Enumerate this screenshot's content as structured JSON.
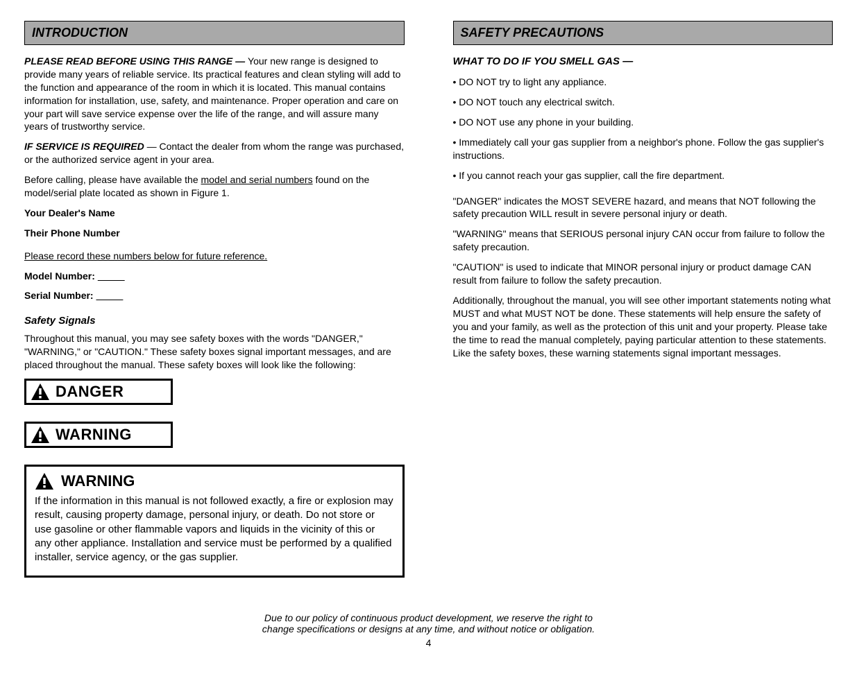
{
  "left": {
    "section_title": "INTRODUCTION",
    "intro_lead": "PLEASE READ BEFORE USING THIS RANGE — ",
    "intro_body": "Your new range is designed to provide many years of reliable service. Its practical features and clean styling will add to the function and appearance of the room in which it is located. This manual contains information for installation, use, safety, and maintenance. Proper operation and care on your part will save service expense over the life of the range, and will assure many years of trustworthy service.",
    "service_lead": "IF SERVICE IS REQUIRED ",
    "service_body1": "— Contact the dealer from whom the range was purchased, or the authorized service agent in your area.",
    "service_body2_a": "Before calling, please have available the ",
    "service_body2_b": "model and serial numbers",
    "service_body2_c": " found on the model/serial plate located as shown in Figure 1.",
    "dealer_label": "Your Dealer's Name",
    "dealer_phone_label": "Their Phone Number",
    "record_line": "Please record these numbers below for future reference.",
    "model_label": "Model Number: ",
    "serial_label": "Serial Number: ",
    "signals_head": "Safety Signals",
    "signals_body": "Throughout this manual, you may see safety boxes with the words \"DANGER,\" \"WARNING,\" or \"CAUTION.\" These safety boxes signal important messages, and are placed throughout the manual. These safety boxes will look like the following:",
    "danger_label": "DANGER",
    "warning_label": "WARNING",
    "warning_big_label": "WARNING",
    "warning_big_body": "If the information in this manual is not followed exactly, a fire or explosion may result, causing property damage, personal injury, or death. Do not store or use gasoline or other flammable vapors and liquids in the vicinity of this or any other appliance. Installation and service must be performed by a qualified installer, service agency, or the gas supplier."
  },
  "right": {
    "section_title": "SAFETY PRECAUTIONS",
    "sp_head": "WHAT TO DO IF YOU SMELL GAS —",
    "sp_b1": "DO NOT try to light any appliance.",
    "sp_b2": "DO NOT touch any electrical switch.",
    "sp_b3": "DO NOT use any phone in your building.",
    "sp_b4": "Immediately call your gas supplier from a neighbor's phone. Follow the gas supplier's instructions.",
    "sp_b5": "If you cannot reach your gas supplier, call the fire department.",
    "danger_p": "\"DANGER\" indicates the MOST SEVERE hazard, and means that NOT following the safety precaution WILL result in severe personal injury or death.",
    "warning_p": "\"WARNING\" means that SERIOUS personal injury CAN occur from failure to follow the safety precaution.",
    "caution_p": "\"CAUTION\" is used to indicate that MINOR personal injury or product damage CAN result from failure to follow the safety precaution.",
    "final_p": "Additionally, throughout the manual, you will see other important statements noting what MUST and what MUST NOT be done. These statements will help ensure the safety of you and your family, as well as the protection of this unit and your property. Please take the time to read the manual completely, paying particular attention to these statements. Like the safety boxes, these warning statements signal important messages."
  },
  "footer1": "Due to our policy of continuous product development, we reserve the right to",
  "footer2": "change specifications or designs at any time, and without notice or obligation.",
  "page": "4"
}
